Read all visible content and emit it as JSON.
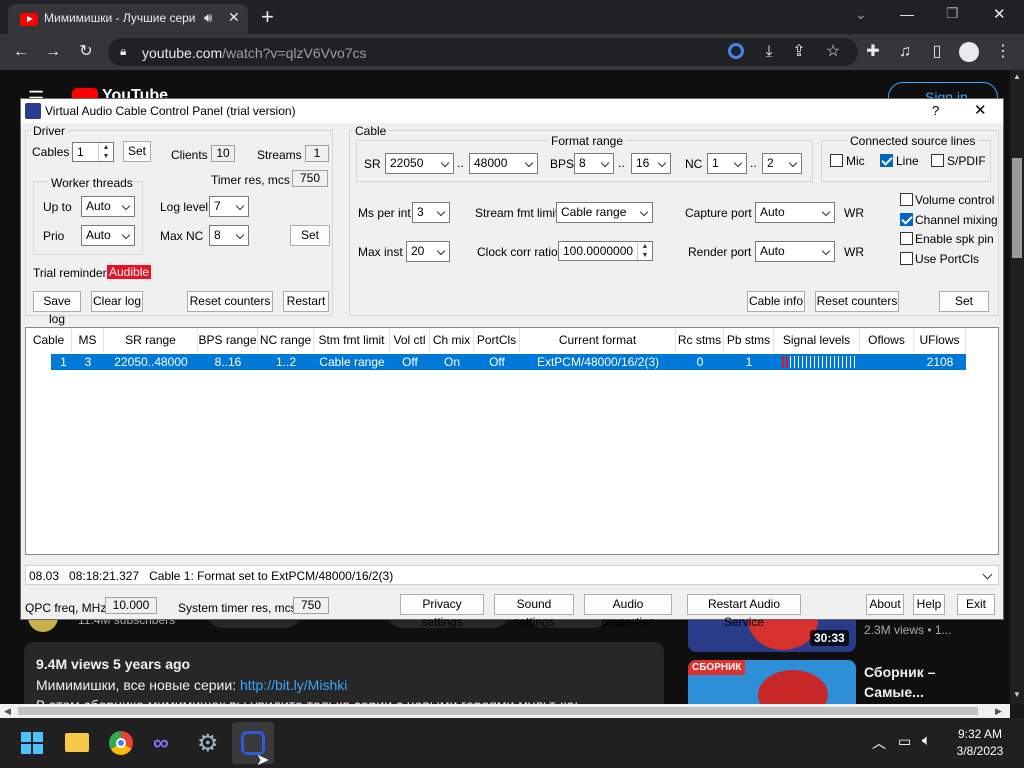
{
  "browser": {
    "tab_title": "Мимимишки - Лучшие сери",
    "url_host": "youtube.com",
    "url_path": "/watch?v=qlzV6Vvo7cs"
  },
  "yt": {
    "subscribers": "11.4M subscribers",
    "views_line": "9.4M views  5 years ago",
    "desc_prefix": "Мимимишки, все новые серии: ",
    "desc_link": "http://bit.ly/Mishki",
    "desc_cut": "В этом сборнике мимимишек вы увидите только серии с новыми героями мульт-ка:",
    "side1_duration": "30:33",
    "side1_meta": "2.3M views  •  1...",
    "side2_badge": "СБОРНИК",
    "side2_title": "Сборник – Самые...",
    "logo_text": "YouTube",
    "sign_in": "Sign in"
  },
  "vac": {
    "title": "Virtual Audio Cable Control Panel (trial version)",
    "help": "?",
    "close": "✕",
    "driver": {
      "group": "Driver",
      "cables_label": "Cables",
      "cables_value": "1",
      "set_label": "Set",
      "clients_label": "Clients",
      "clients_value": "10",
      "streams_label": "Streams",
      "streams_value": "1",
      "timer_label": "Timer res, mcs",
      "timer_value": "750",
      "worker_group": "Worker threads",
      "upto_label": "Up to",
      "upto_value": "Auto",
      "prio_label": "Prio",
      "prio_value": "Auto",
      "loglevel_label": "Log level",
      "loglevel_value": "7",
      "maxnc_label": "Max NC",
      "maxnc_value": "8",
      "set2_label": "Set",
      "trial_label": "Trial reminder",
      "trial_value": "Audible",
      "save_log": "Save log",
      "clear_log": "Clear log",
      "reset_counters": "Reset counters",
      "restart": "Restart"
    },
    "cable": {
      "group": "Cable",
      "format_group": "Format range",
      "sr_label": "SR",
      "sr_min": "22050",
      "sr_max": "48000",
      "dots": "..",
      "bps_label": "BPS",
      "bps_min": "8",
      "bps_max": "16",
      "nc_label": "NC",
      "nc_min": "1",
      "nc_max": "2",
      "source_group": "Connected source lines",
      "mic": "Mic",
      "line": "Line",
      "spdif": "S/PDIF",
      "ms_label": "Ms per int",
      "ms_value": "3",
      "sfl_label": "Stream fmt limit",
      "sfl_value": "Cable range",
      "capture_label": "Capture port",
      "capture_value": "Auto",
      "wr1": "WR",
      "maxinst_label": "Max inst",
      "maxinst_value": "20",
      "ccr_label": "Clock corr ratio",
      "ccr_value": "100.0000000",
      "render_label": "Render port",
      "render_value": "Auto",
      "wr2": "WR",
      "volume_control": "Volume control",
      "channel_mixing": "Channel mixing",
      "enable_spk_pin": "Enable spk pin",
      "use_portcls": "Use PortCls",
      "cable_info": "Cable info",
      "reset_counters": "Reset counters",
      "set_label": "Set"
    },
    "table": {
      "headers": [
        "Cable",
        "MS",
        "SR range",
        "BPS range",
        "NC range",
        "Stm fmt limit",
        "Vol ctl",
        "Ch mix",
        "PortCls",
        "Current format",
        "Rc stms",
        "Pb stms",
        "Signal levels",
        "Oflows",
        "UFlows"
      ],
      "row": [
        "1",
        "3",
        "22050..48000",
        "8..16",
        "1..2",
        "Cable range",
        "Off",
        "On",
        "Off",
        "ExtPCM/48000/16/2(3)",
        "0",
        "1",
        "",
        "",
        "2108"
      ]
    },
    "status_text": "08.03   08:18:21.327   Cable 1: Format set to ExtPCM/48000/16/2(3)",
    "qpc_label": "QPC freq, MHz",
    "qpc_value": "10.000",
    "systimer_label": "System timer res, mcs",
    "systimer_value": "750",
    "privacy": "Privacy settings",
    "sound": "Sound settings",
    "audio_props": "Audio properties",
    "restart_audio": "Restart Audio Service",
    "about": "About",
    "help_btn": "Help",
    "exit": "Exit"
  },
  "taskbar": {
    "time": "9:32 AM",
    "date": "3/8/2023"
  }
}
